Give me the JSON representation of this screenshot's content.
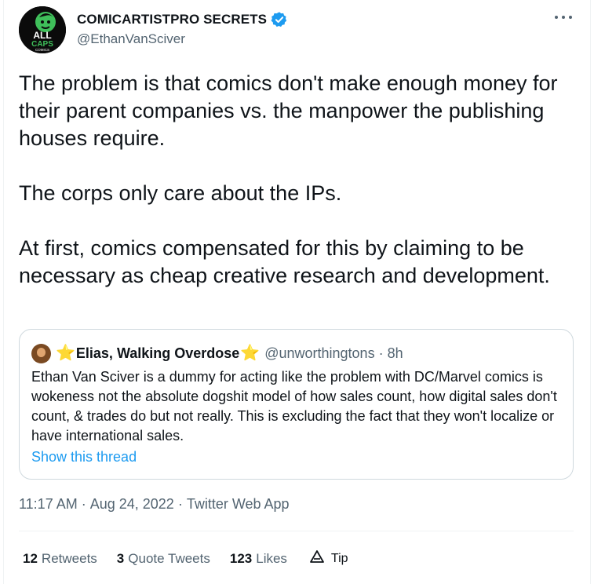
{
  "author": {
    "display_name": "COMICARTISTPRO SECRETS",
    "handle": "@EthanVanSciver",
    "avatar_text_1": "ALL",
    "avatar_text_2": "CAPS",
    "avatar_text_3": "COMICS",
    "verified_color": "#1d9bf0"
  },
  "tweet": {
    "paragraphs": [
      "The problem is that comics don't make enough money for their parent companies vs. the manpower the publishing houses require.",
      "The corps only care about the IPs.",
      "At first, comics compensated for this by claiming to be necessary as cheap creative research and development."
    ]
  },
  "quote": {
    "star_left": "⭐",
    "name": "Elias, Walking Overdose",
    "star_right": "⭐",
    "handle": "@unworthingtons",
    "separator": "·",
    "time": "8h",
    "text": "Ethan Van Sciver is a dummy for acting like the problem with DC/Marvel comics is wokeness not the absolute dogshit model of how sales count, how digital sales don't count, & trades do but not really. This is excluding the fact that they won't localize or have international sales.",
    "show_thread": "Show this thread"
  },
  "meta": {
    "time": "11:17 AM",
    "separator": "·",
    "date": "Aug 24, 2022",
    "app": "Twitter Web App"
  },
  "stats": {
    "retweets_count": "12",
    "retweets_label": "Retweets",
    "quotes_count": "3",
    "quotes_label": "Quote Tweets",
    "likes_count": "123",
    "likes_label": "Likes",
    "tip_label": "Tip"
  },
  "icons": {
    "more": "more-horizontal-icon",
    "verified": "verified-badge-icon",
    "tip": "tip-jar-icon"
  },
  "colors": {
    "link": "#1d9bf0",
    "secondary_text": "#536471",
    "border": "#cfd9de"
  }
}
